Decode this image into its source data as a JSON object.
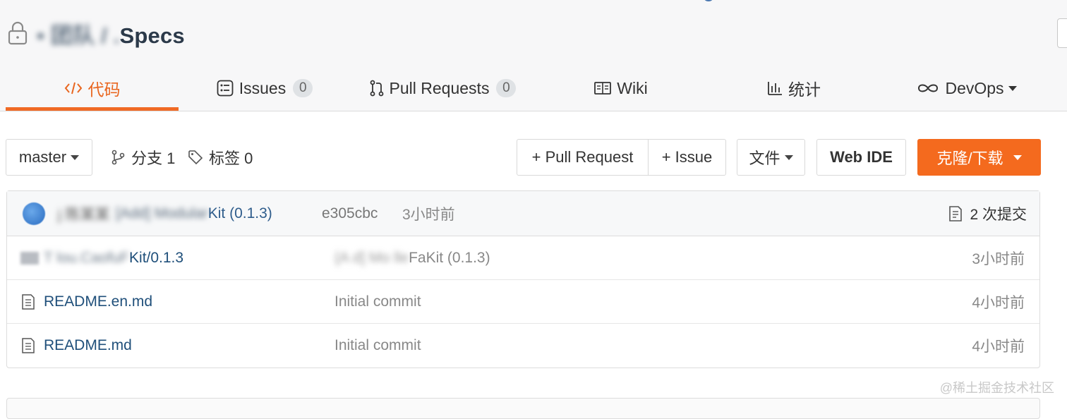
{
  "repo": {
    "title_blurred": "• 团队 / .",
    "title_suffix": "Specs"
  },
  "tabs": [
    {
      "label": "代码",
      "icon": "code-icon"
    },
    {
      "label": "Issues",
      "badge": "0",
      "icon": "issues-icon"
    },
    {
      "label": "Pull Requests",
      "badge": "0",
      "icon": "pull-request-icon"
    },
    {
      "label": "Wiki",
      "icon": "wiki-icon"
    },
    {
      "label": "统计",
      "icon": "stats-icon"
    },
    {
      "label": "DevOps",
      "icon": "infinity-icon"
    }
  ],
  "toolbar": {
    "branch": "master",
    "branches_label": "分支 1",
    "tags_label": "标签 0",
    "pull_request_btn": "+ Pull Request",
    "issue_btn": "+ Issue",
    "file_btn": "文件",
    "web_ide_btn": "Web IDE",
    "clone_btn": "克隆/下载"
  },
  "commit": {
    "author_blurred": "j 陈某某",
    "message_blurred": "[Add] Modular ",
    "message_suffix": "Kit (0.1.3)",
    "hash": "e305cbc",
    "time": "3小时前",
    "count_label": "2 次提交"
  },
  "files": [
    {
      "type": "folder",
      "name_blurred": "T  lou.CaofuF ",
      "name_visible": "Kit/0.1.3",
      "msg_blurred": "{A  d] Mo lle  ",
      "msg_visible": "FaKit (0.1.3)",
      "time": "3小时前"
    },
    {
      "type": "file",
      "name": "README.en.md",
      "msg": "Initial commit",
      "time": "4小时前"
    },
    {
      "type": "file",
      "name": "README.md",
      "msg": "Initial commit",
      "time": "4小时前"
    }
  ],
  "watermark": "@稀土掘金技术社区",
  "colors": {
    "accent": "#f46a1e",
    "link": "#1f4f7a",
    "header_bg": "#f7f7f8"
  }
}
